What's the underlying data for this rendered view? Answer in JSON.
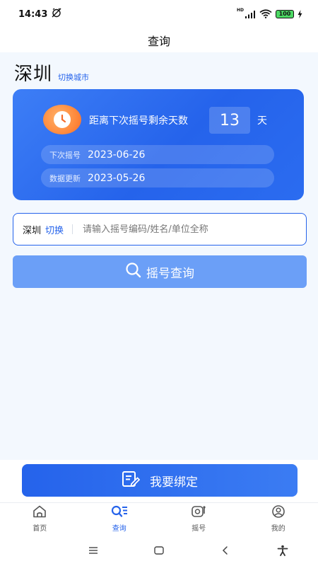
{
  "status_bar": {
    "time": "14:43",
    "network": "HD",
    "battery": "100"
  },
  "header": {
    "title": "查询"
  },
  "city": {
    "name": "深圳",
    "switch_label": "切换城市"
  },
  "countdown": {
    "label": "距离下次摇号剩余天数",
    "days": "13",
    "unit": "天",
    "next_draw_label": "下次摇号",
    "next_draw_date": "2023-06-26",
    "update_label": "数据更新",
    "update_date": "2023-05-26"
  },
  "search": {
    "city": "深圳",
    "switch_label": "切换",
    "placeholder": "请输入摇号编码/姓名/单位全称",
    "value": ""
  },
  "query_button": {
    "label": "摇号查询"
  },
  "bind_button": {
    "label": "我要绑定"
  },
  "tabs": [
    {
      "label": "首页",
      "icon": "home-icon",
      "active": false
    },
    {
      "label": "查询",
      "icon": "query-icon",
      "active": true
    },
    {
      "label": "摇号",
      "icon": "lottery-icon",
      "active": false
    },
    {
      "label": "我的",
      "icon": "profile-icon",
      "active": false
    }
  ],
  "colors": {
    "accent": "#2563eb",
    "card_blue": "#3d7ef6",
    "query_button": "#6b9ff7",
    "clock_orange": "#ff8a3d",
    "page_background": "#f3f8fe"
  }
}
